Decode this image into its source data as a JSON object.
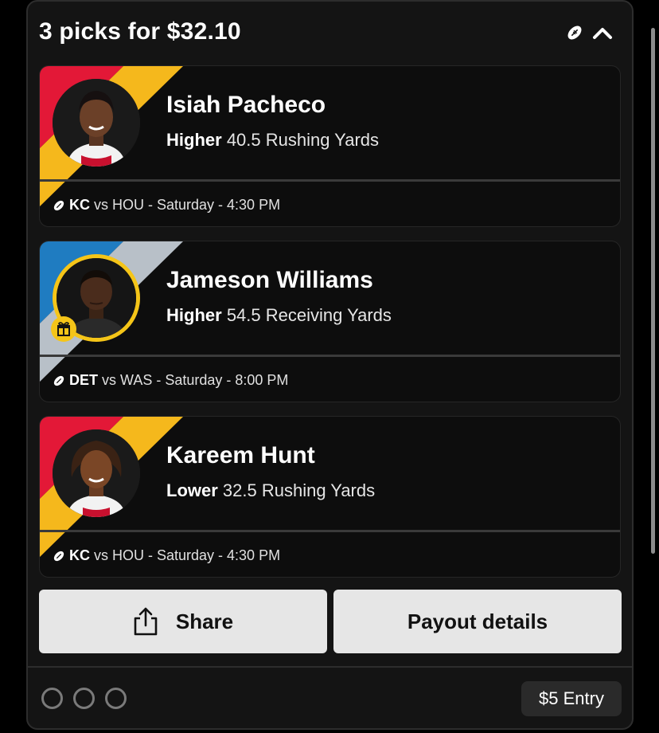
{
  "header": {
    "title": "3 picks for $32.10",
    "sport_icon": "football-icon",
    "collapse_icon": "chevron-up-icon"
  },
  "picks": [
    {
      "player": "Isiah Pacheco",
      "direction": "Higher",
      "projection": "40.5 Rushing Yards",
      "team": "KC",
      "matchup": "vs HOU - Saturday - 4:30 PM",
      "band_colors": [
        "#e31837",
        "#f5b81c"
      ],
      "boosted": false
    },
    {
      "player": "Jameson Williams",
      "direction": "Higher",
      "projection": "54.5 Receiving Yards",
      "team": "DET",
      "matchup": "vs WAS - Saturday - 8:00 PM",
      "band_colors": [
        "#1f7cc1",
        "#b8c0c8"
      ],
      "boosted": true
    },
    {
      "player": "Kareem Hunt",
      "direction": "Lower",
      "projection": "32.5 Rushing Yards",
      "team": "KC",
      "matchup": "vs HOU - Saturday - 4:30 PM",
      "band_colors": [
        "#e31837",
        "#f5b81c"
      ],
      "boosted": false
    }
  ],
  "actions": {
    "share_label": "Share",
    "payout_label": "Payout details"
  },
  "footer": {
    "status_dot_count": 3,
    "entry_label": "$5 Entry"
  },
  "colors": {
    "background": "#000000",
    "card": "#141414",
    "button": "#e6e6e6",
    "boost_gold": "#f5c518"
  }
}
